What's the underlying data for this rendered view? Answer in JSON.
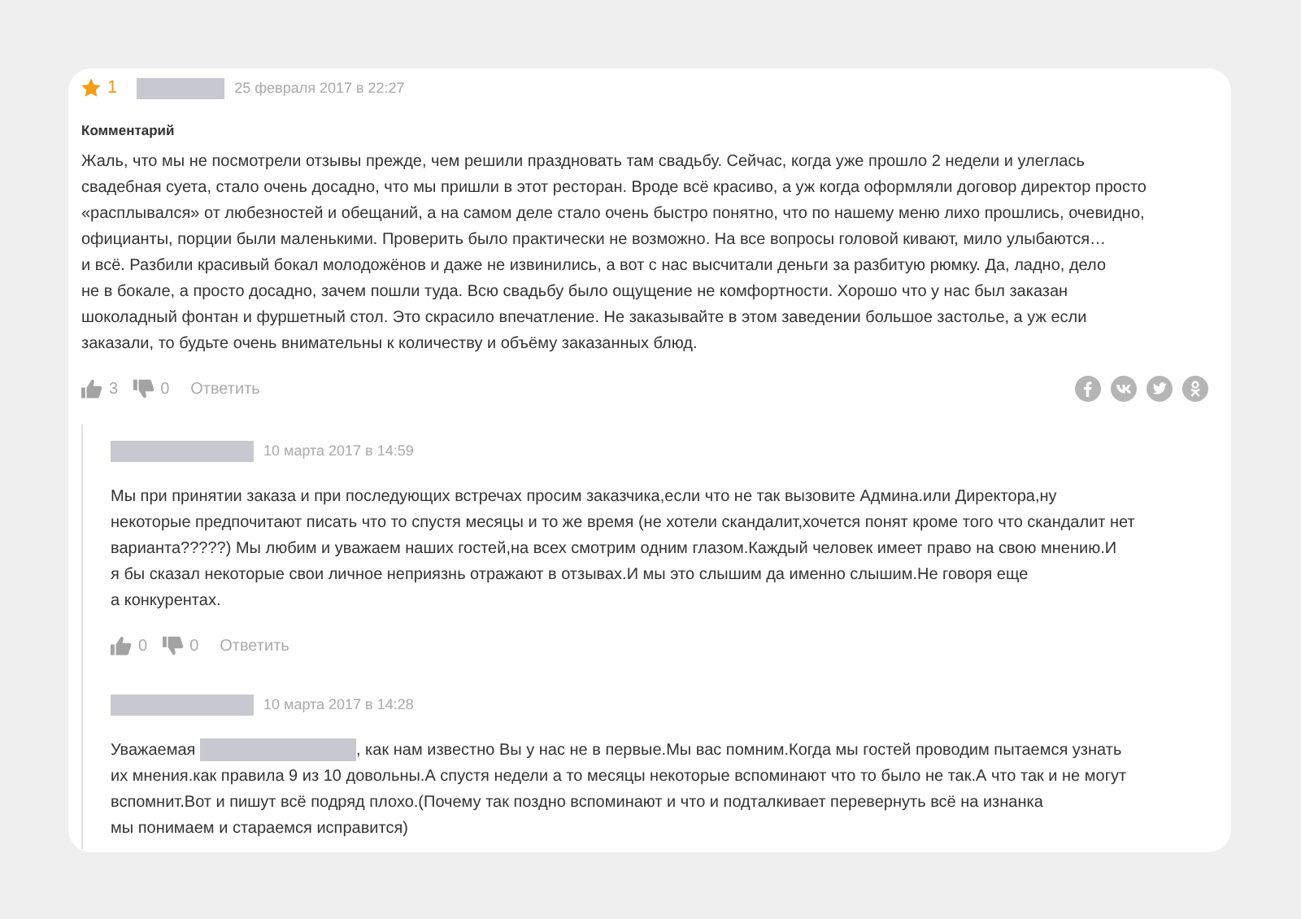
{
  "comment": {
    "rating": "1",
    "author_redacted": true,
    "date": "25 февраля 2017 в 22:27",
    "heading": "Комментарий",
    "lines": [
      [
        {
          "kind": "text",
          "text": "Жаль, что мы не посмотрели отзывы прежде, чем решили праздновать там свадьбу. Сейчас, когда уже прошло 2 недели и улеглась"
        }
      ],
      [
        {
          "kind": "text",
          "text": "свадебная суета, стало очень досадно, что мы пришли в этот ресторан. Вроде всё красиво, а уж когда оформляли договор директор просто"
        }
      ],
      [
        {
          "kind": "text",
          "text": "«расплывался» от любезностей и обещаний, а на самом деле стало очень быстро понятно, что по нашему меню лихо прошлись, очевидно,"
        }
      ],
      [
        {
          "kind": "text",
          "text": "официанты, порции были маленькими. Проверить было практически не возможно. На все вопросы головой кивают, мило улыбаются…"
        }
      ],
      [
        {
          "kind": "text",
          "text": "и всё. Разбили красивый бокал молодожёнов и даже не извинились, а вот с нас высчитали деньги за разбитую рюмку. Да, ладно, дело"
        }
      ],
      [
        {
          "kind": "text",
          "text": "не в бокале, а просто досадно, зачем пошли туда. Всю свадьбу было ощущение не комфортности. Хорошо что у нас был заказан"
        }
      ],
      [
        {
          "kind": "text",
          "text": "шоколадный фонтан и фуршетный стол. Это скрасило впечатление. Не заказывайте в этом заведении большое застолье, а уж если"
        }
      ],
      [
        {
          "kind": "text",
          "text": "заказали, то будьте очень внимательны к количеству и объёму заказанных блюд."
        }
      ]
    ],
    "likes": "3",
    "dislikes": "0",
    "reply_label": "Ответить"
  },
  "replies": [
    {
      "author_redacted": true,
      "date": "10 марта 2017 в 14:59",
      "lines": [
        [
          {
            "kind": "text",
            "text": "Мы при принятии заказа и при последующих встречах просим заказчика,если что не так вызовите Админа.или Директора,ну"
          }
        ],
        [
          {
            "kind": "text",
            "text": "некоторые предпочитают писать что то спустя месяцы и то же время (не хотели скандалит,хочется понят кроме того что скандалит нет"
          }
        ],
        [
          {
            "kind": "text",
            "text": "варианта?????) Мы любим и уважаем наших гостей,на всех смотрим одним глазом.Каждый человек имеет право на свою мнению.И"
          }
        ],
        [
          {
            "kind": "text",
            "text": "я бы сказал некоторые свои личное неприязнь отражают в отзывах.И мы это слышим да именно слышим.Не говоря еще"
          }
        ],
        [
          {
            "kind": "text",
            "text": "а конкурентах."
          }
        ]
      ],
      "likes": "0",
      "dislikes": "0",
      "reply_label": "Ответить"
    },
    {
      "author_redacted": true,
      "date": "10 марта 2017 в 14:28",
      "lines": [
        [
          {
            "kind": "text",
            "text": "Уважаемая "
          },
          {
            "kind": "redacted"
          },
          {
            "kind": "text",
            "text": ", как нам известно Вы у нас не в первые.Мы вас помним.Когда мы гостей проводим пытаемся узнать"
          }
        ],
        [
          {
            "kind": "text",
            "text": "их мнения.как правила 9 из 10 довольны.А спустя недели а то месяцы некоторые вспоминают что то было не так.А что так и не могут"
          }
        ],
        [
          {
            "kind": "text",
            "text": "вспомнит.Вот и пишут всё подряд плохо.(Почему так поздно вспоминают и что и подталкивает перевернуть всё на изнанка"
          }
        ],
        [
          {
            "kind": "text",
            "text": "мы понимаем и стараемся исправится)"
          }
        ]
      ]
    }
  ]
}
